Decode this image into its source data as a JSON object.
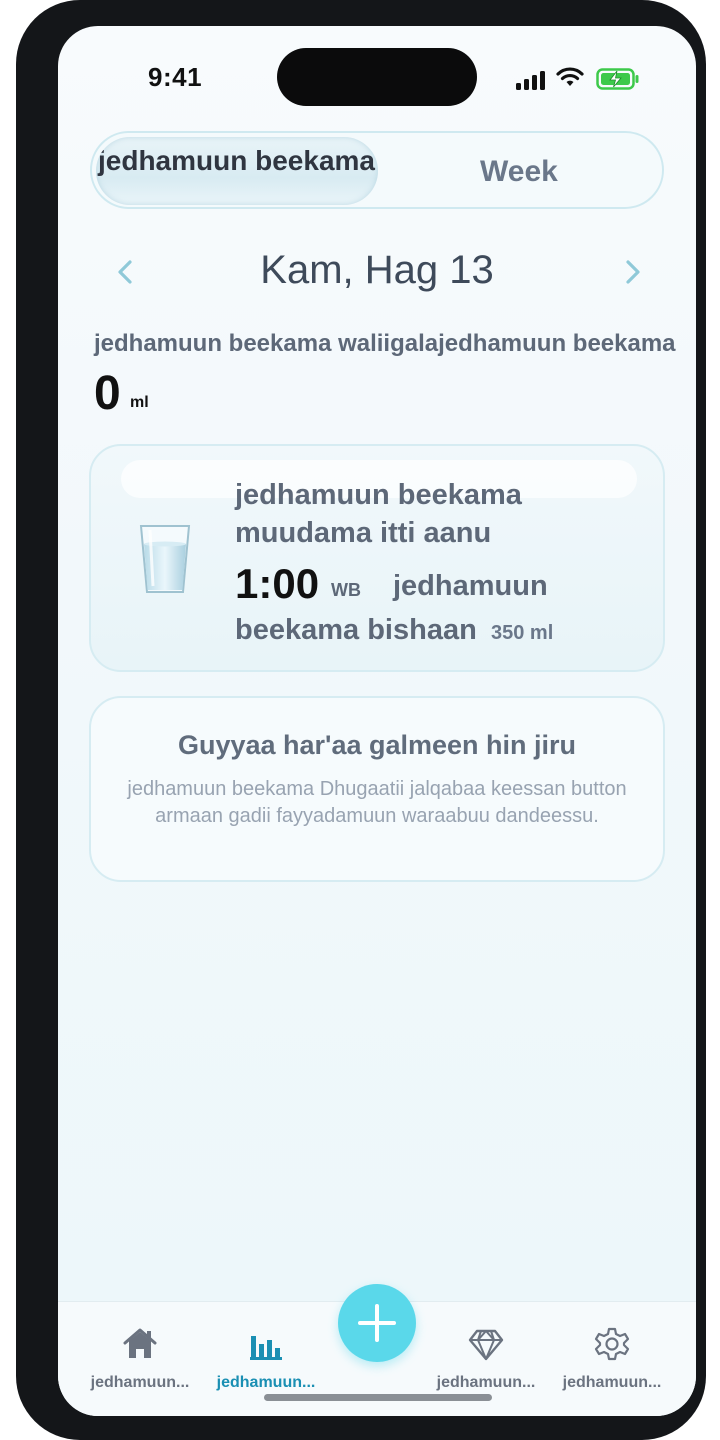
{
  "status_bar": {
    "time": "9:41"
  },
  "segment": {
    "active_label": "jedhamuun beekama",
    "week_label": "Week"
  },
  "date_nav": {
    "title": "Kam, Hag 13"
  },
  "daily": {
    "label": "jedhamuun beekama waliigalajedhamuun beekama",
    "value": "0",
    "unit": "ml"
  },
  "reminder": {
    "title": "jedhamuun beekama muudama itti aanu",
    "time": "1:00",
    "period": "WB",
    "name_part1": "jedhamuun",
    "name_part2": "beekama bishaan",
    "amount": "350 ml"
  },
  "empty_state": {
    "title": "Guyyaa har'aa galmeen hin jiru",
    "description": "jedhamuun beekama Dhugaatii jalqabaa keessan button armaan gadii fayyadamuun waraabuu dandeessu."
  },
  "tabs": [
    {
      "label": "jedhamuun...",
      "icon": "home-icon",
      "active": false
    },
    {
      "label": "jedhamuun...",
      "icon": "bar-chart-icon",
      "active": true
    },
    {
      "label": "jedhamuun...",
      "icon": "diamond-icon",
      "active": false
    },
    {
      "label": "jedhamuun...",
      "icon": "gear-icon",
      "active": false
    }
  ],
  "colors": {
    "accent": "#1a8fb3",
    "fab": "#5ad8ea",
    "battery": "#3dc94a"
  }
}
